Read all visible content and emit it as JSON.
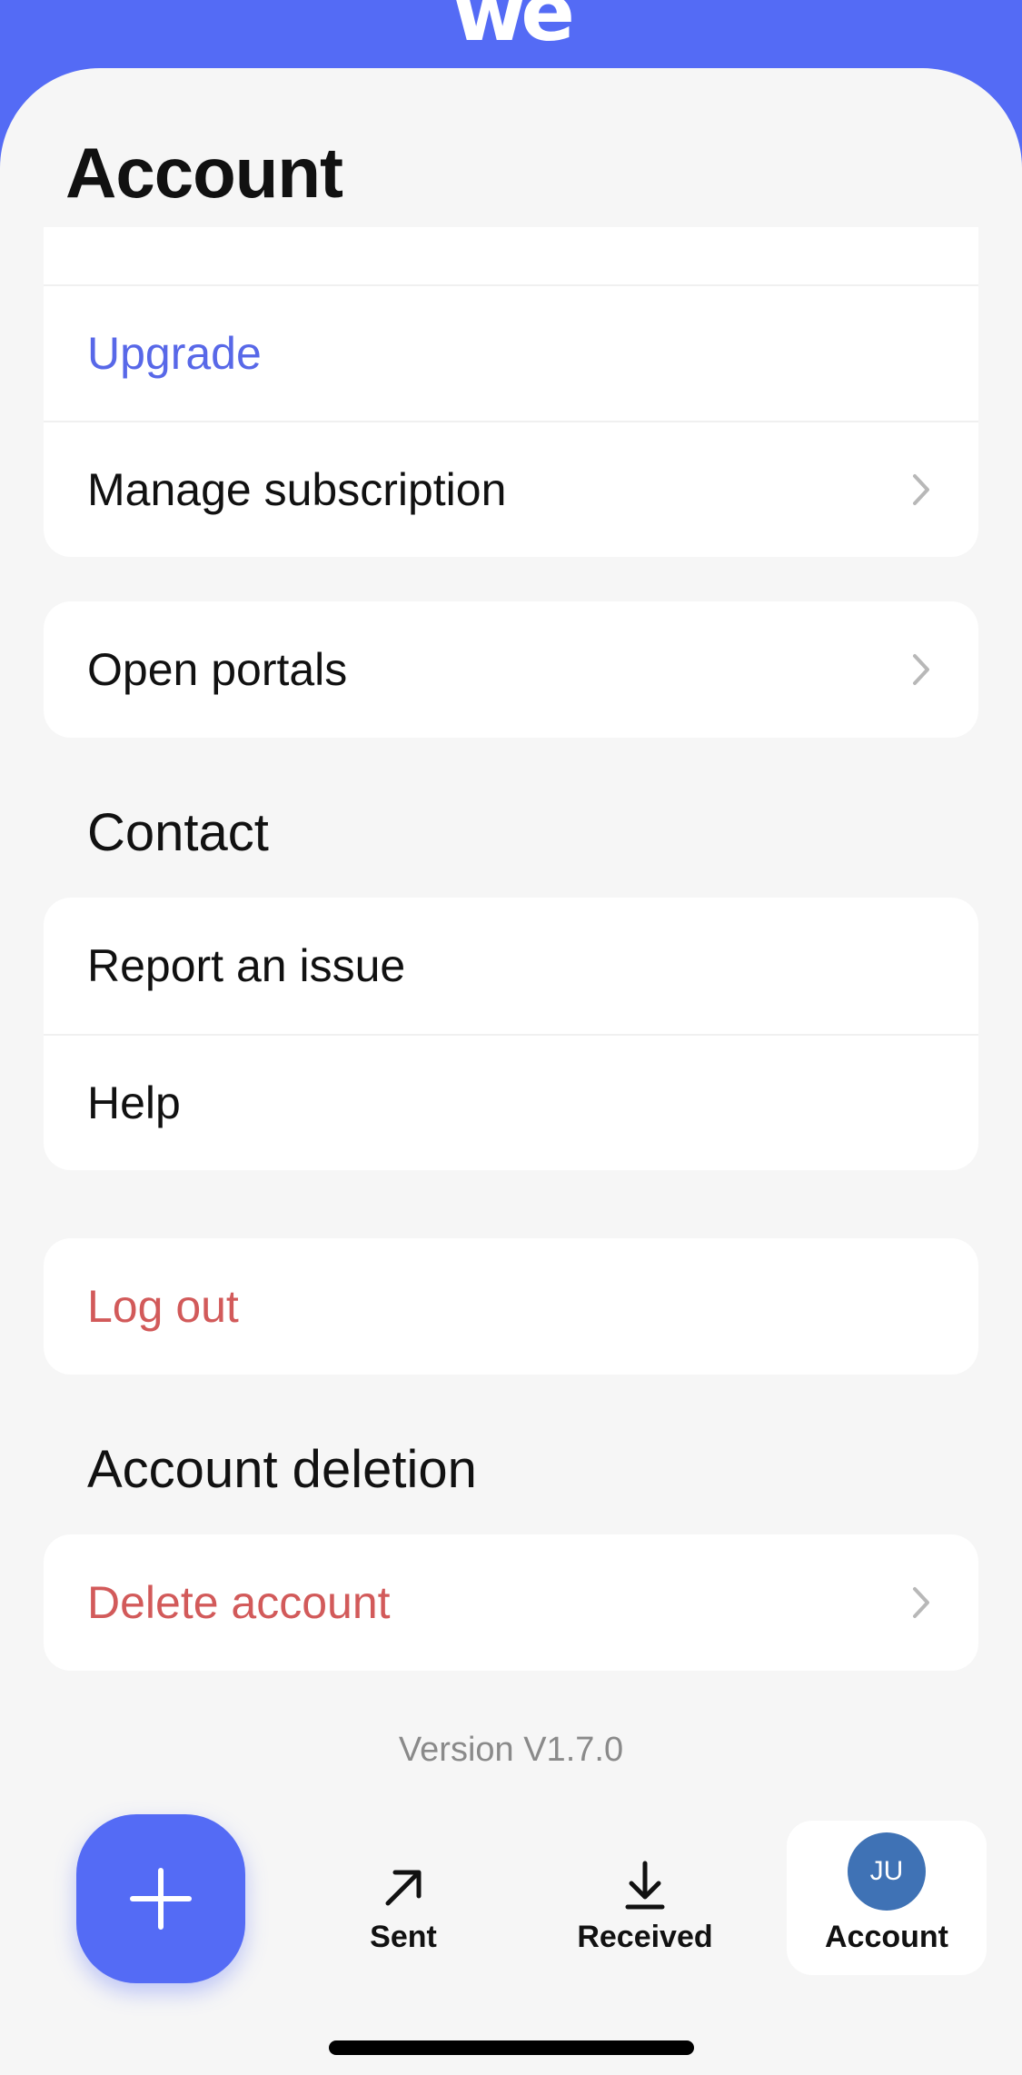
{
  "header": {
    "logo_text": "we"
  },
  "page": {
    "title": "Account"
  },
  "subscription_card": {
    "upgrade_label": "Upgrade",
    "manage_label": "Manage subscription"
  },
  "portals_card": {
    "open_portals_label": "Open portals"
  },
  "contact_section": {
    "title": "Contact",
    "report_label": "Report an issue",
    "help_label": "Help"
  },
  "logout_card": {
    "logout_label": "Log out"
  },
  "deletion_section": {
    "title": "Account deletion",
    "delete_label": "Delete account"
  },
  "version_text": "Version V1.7.0",
  "tabbar": {
    "new_icon": "plus-icon",
    "sent_label": "Sent",
    "sent_icon": "arrow-up-right-icon",
    "received_label": "Received",
    "received_icon": "download-arrow-icon",
    "account_label": "Account",
    "avatar_initials": "JU",
    "active_tab": "Account"
  },
  "colors": {
    "brand": "#546bf5",
    "accent_text": "#5868e8",
    "danger_text": "#d25a5a",
    "avatar": "#3f72b5",
    "background": "#f6f6f6"
  }
}
